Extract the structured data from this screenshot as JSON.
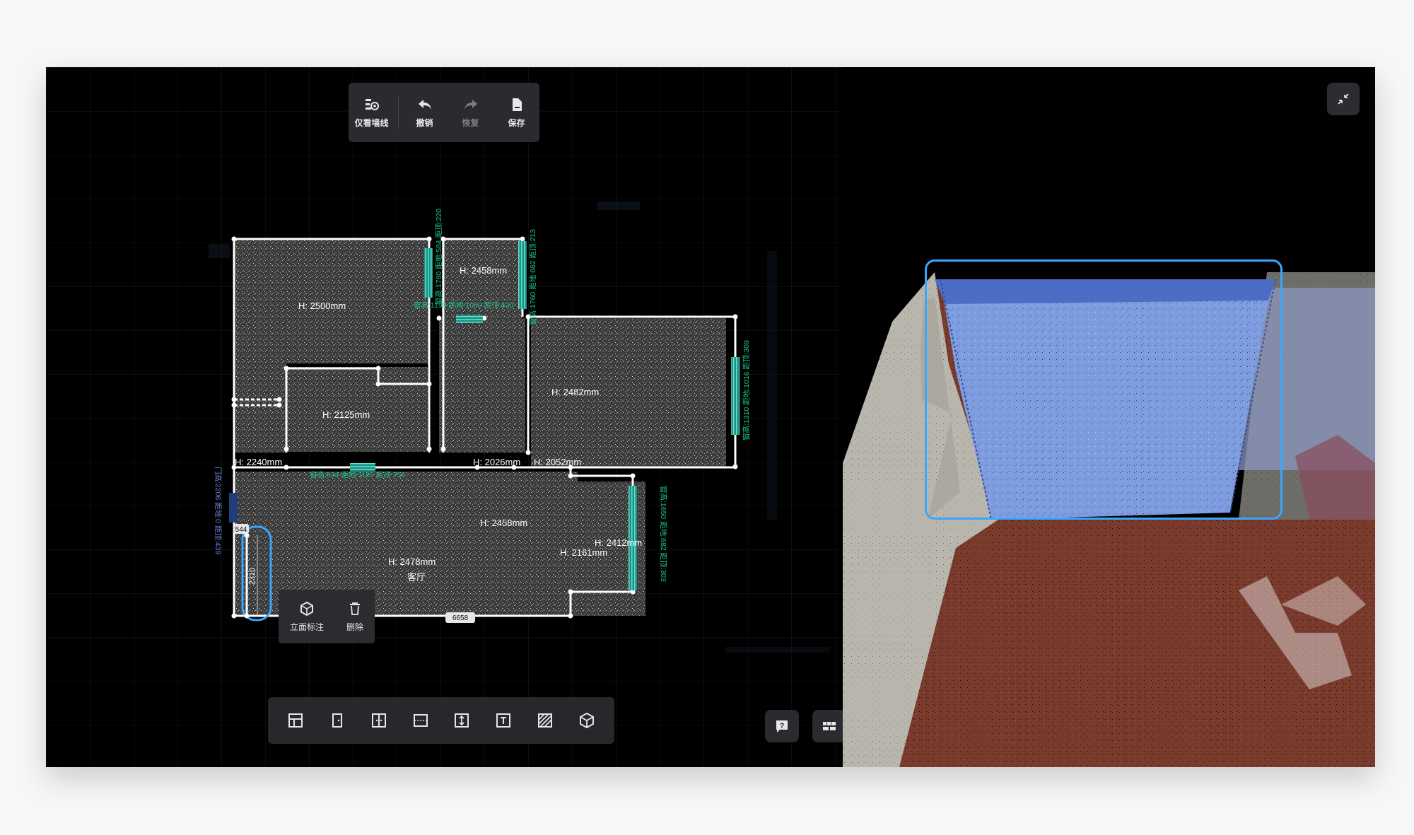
{
  "toolbar": {
    "items": [
      {
        "label": "仅看墙线",
        "icon": "wall-lines-view-icon",
        "enabled": true
      },
      {
        "label": "撤销",
        "icon": "undo-icon",
        "enabled": true
      },
      {
        "label": "恢复",
        "icon": "redo-icon",
        "enabled": false
      },
      {
        "label": "保存",
        "icon": "save-icon",
        "enabled": true
      }
    ]
  },
  "rooms": [
    {
      "height": "H: 2500mm"
    },
    {
      "height": "H: 2458mm"
    },
    {
      "height": "H: 2125mm"
    },
    {
      "height": "H: 2482mm"
    },
    {
      "height": "H: 2240mm"
    },
    {
      "height": "H: 2026mm"
    },
    {
      "height": "H: 2052mm"
    },
    {
      "height": "H: 2458mm"
    },
    {
      "height": "H: 2478mm",
      "name": "客厅"
    },
    {
      "height": "H: 2412mm"
    },
    {
      "height": "H: 2161mm"
    }
  ],
  "annotations": {
    "window_top_center": "窗高:1199 距地:1000 距顶:430",
    "window_left_vertical": "窗高:1780 距地:584 距顶:220",
    "window_right_top_vertical": "窗高:1760 距地:662 距顶:213",
    "window_right_room_vertical": "窗高:1310 距地:1016 距顶:309",
    "window_bottom_center": "窗高:694 距地:1185 距顶:756",
    "door_left_vertical": "门高:2206 距地:0 距顶:439",
    "window_lower_right_vertical": "窗高:1650 距地:682 距顶:303"
  },
  "dimensions": {
    "selected_wall_length": "2310",
    "selected_wall_small": "544",
    "bottom_wall_length": "6658"
  },
  "context_menu": {
    "items": [
      {
        "label": "立面标注",
        "icon": "elevation-annotation-icon"
      },
      {
        "label": "删除",
        "icon": "delete-icon"
      }
    ]
  },
  "bottom_toolbar": {
    "tools": [
      {
        "icon": "room-tool-icon"
      },
      {
        "icon": "door-tool-icon"
      },
      {
        "icon": "double-door-tool-icon"
      },
      {
        "icon": "window-tool-icon"
      },
      {
        "icon": "height-measure-tool-icon"
      },
      {
        "icon": "text-tool-icon"
      },
      {
        "icon": "hatch-tool-icon"
      },
      {
        "icon": "3d-cube-tool-icon"
      }
    ]
  },
  "colors": {
    "accent": "#3aa7ff",
    "annotation_green": "#19c38a",
    "window_teal": "#2bb3a4",
    "wall_white": "#ffffff"
  }
}
